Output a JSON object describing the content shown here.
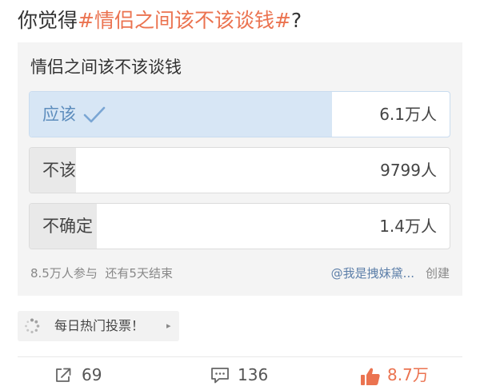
{
  "post": {
    "title_prefix": "你觉得",
    "topic": "#情侣之间该不该谈钱#",
    "title_suffix": "?"
  },
  "poll": {
    "question": "情侣之间该不该谈钱",
    "options": [
      {
        "label": "应该",
        "count": "6.1万人",
        "share": 0.72,
        "selected": true
      },
      {
        "label": "不该",
        "count": "9799人",
        "share": 0.11,
        "selected": false
      },
      {
        "label": "不确定",
        "count": "1.4万人",
        "share": 0.16,
        "selected": false
      }
    ],
    "participants": "8.5万人参与",
    "remaining": "还有5天结束",
    "creator": "@我是拽妹黛...",
    "created_label": "创建"
  },
  "daily_vote": {
    "icon": "loading-spinner-icon",
    "label": "每日热门投票！",
    "arrow": "▸"
  },
  "actions": {
    "share_count": "69",
    "comment_count": "136",
    "like_count": "8.7万"
  },
  "colors": {
    "topic": "#eb7350",
    "selected_fill": "#d7e6f5",
    "selected_text": "#5d8dbd",
    "bar_fill": "#e9e9e9",
    "like": "#eb7350"
  }
}
